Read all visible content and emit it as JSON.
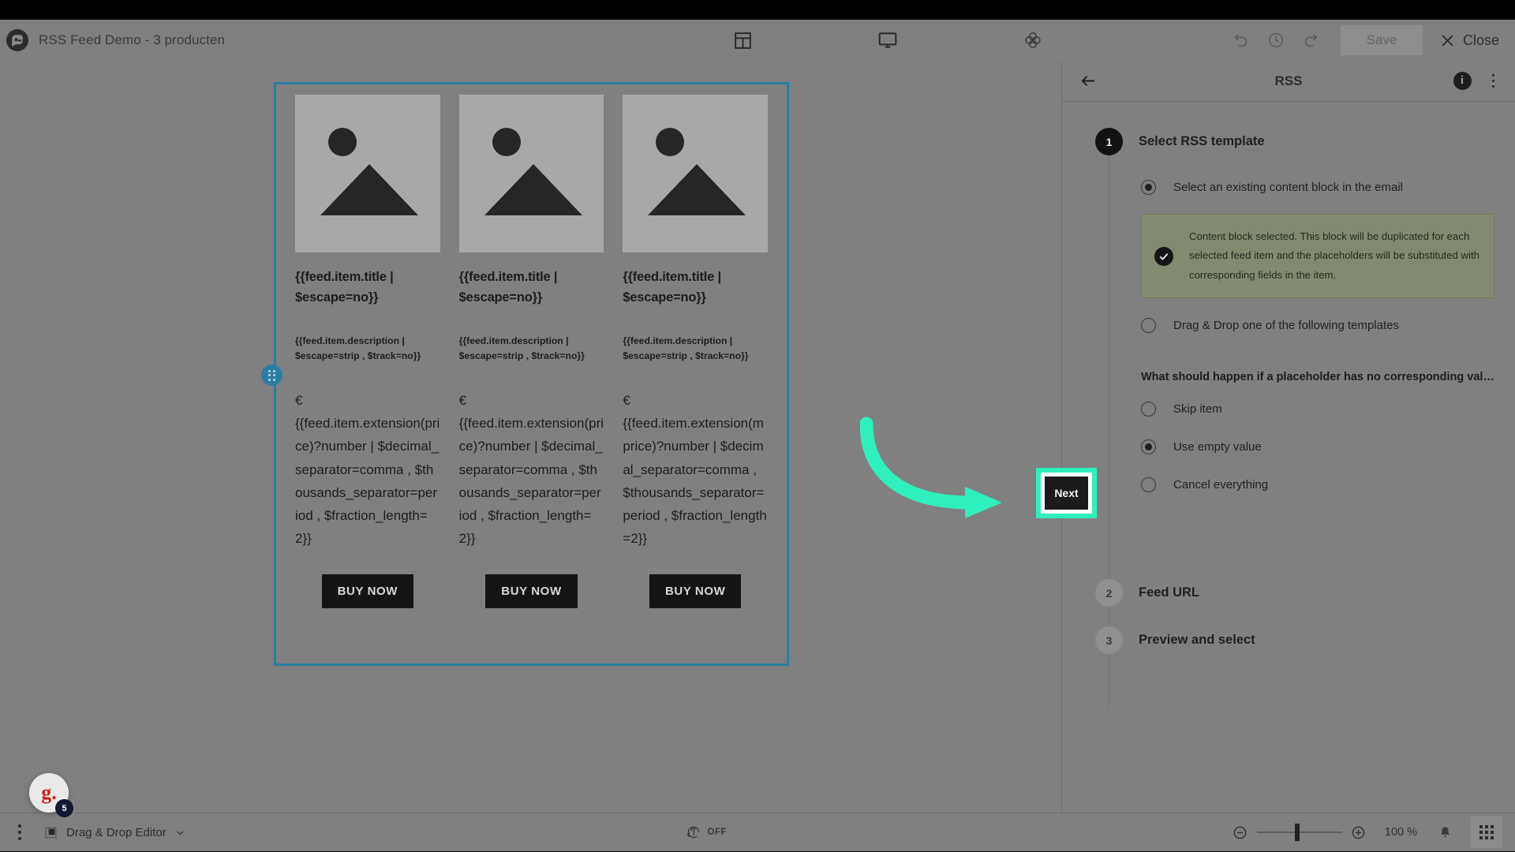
{
  "topbar": {
    "logo_icon": "brand-logo-icon",
    "document_title": "RSS Feed Demo - 3 producten",
    "tools": [
      {
        "name": "layout-icon",
        "label": "Layout"
      },
      {
        "name": "desktop-preview-icon",
        "label": "Preview"
      },
      {
        "name": "settings-icon",
        "label": "Settings"
      }
    ],
    "history": [
      {
        "name": "undo-icon",
        "label": "Undo"
      },
      {
        "name": "history-icon",
        "label": "History"
      },
      {
        "name": "redo-icon",
        "label": "Redo"
      }
    ],
    "save_label": "Save",
    "close_label": "Close"
  },
  "email": {
    "columns": [
      {
        "title": "{{feed.item.title | $escape=no}}",
        "description": "{{feed.item.description | $escape=strip , $track=no}}",
        "currency": "€",
        "price": "{{feed.item.extension(price)?number | $decimal_separator=comma , $thousands_separator=period , $fraction_length=2}}",
        "button": "BUY NOW"
      },
      {
        "title": "{{feed.item.title | $escape=no}}",
        "description": "{{feed.item.description | $escape=strip , $track=no}}",
        "currency": "€",
        "price": "{{feed.item.extension(price)?number | $decimal_separator=comma , $thousands_separator=period , $fraction_length=2}}",
        "button": "BUY NOW"
      },
      {
        "title": "{{feed.item.title | $escape=no}}",
        "description": "{{feed.item.description | $escape=strip , $track=no}}",
        "currency": "€",
        "price": "{{feed.item.extension(mprice)?number | $decimal_separator=comma , $thousands_separator=period , $fraction_length=2}}",
        "button": "BUY NOW"
      }
    ],
    "selection_color": "#2b7fa0"
  },
  "panel": {
    "title": "RSS",
    "back_icon": "back-arrow-icon",
    "info_icon": "info-icon",
    "info_glyph": "i",
    "menu_icon": "more-vertical-icon",
    "steps": [
      {
        "number": "1",
        "label": "Select RSS template",
        "state": "active"
      },
      {
        "number": "2",
        "label": "Feed URL",
        "state": "idle"
      },
      {
        "number": "3",
        "label": "Preview and select",
        "state": "idle"
      }
    ],
    "template_options": [
      {
        "label": "Select an existing content block in the email",
        "selected": true
      },
      {
        "label": "Drag & Drop one of the following templates",
        "selected": false
      }
    ],
    "notice": {
      "icon": "check-circle-icon",
      "text": "Content block selected. This block will be duplicated for each selected feed item and the placeholders will be substituted with corresponding fields in the item.",
      "bg_color": "#828b72"
    },
    "question_label": "What should happen if a placeholder has no corresponding val…",
    "fallback_options": [
      {
        "label": "Skip item",
        "selected": false
      },
      {
        "label": "Use empty value",
        "selected": true
      },
      {
        "label": "Cancel everything",
        "selected": false
      }
    ],
    "next_label": "Next",
    "highlight_color": "#2ff0bd"
  },
  "bottombar": {
    "menu_icon": "more-vertical-icon",
    "editor_icon": "editor-icon",
    "editor_label": "Drag & Drop Editor",
    "editor_chevron": "chevron-down-icon",
    "translate_icon": "auto-translate-icon",
    "translate_state": "OFF",
    "zoom_out_icon": "zoom-out-icon",
    "zoom_in_icon": "zoom-in-icon",
    "zoom_value": "100 %",
    "bell_icon": "notifications-icon",
    "apps_icon": "apps-grid-icon"
  },
  "assistant": {
    "avatar_letter": "g.",
    "badge_count": "5"
  }
}
